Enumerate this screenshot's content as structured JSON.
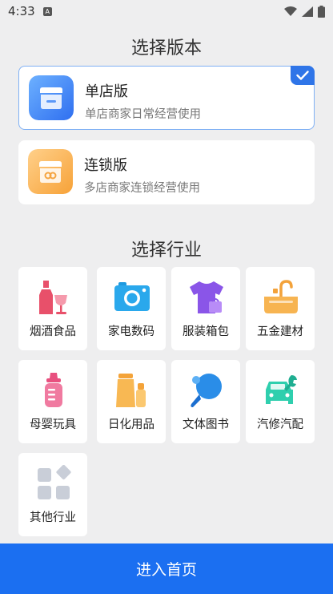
{
  "status_bar": {
    "time": "4:33",
    "notification_badge": "A"
  },
  "version_section": {
    "title": "选择版本",
    "options": [
      {
        "name": "单店版",
        "description": "单店商家日常经营使用",
        "selected": true
      },
      {
        "name": "连锁版",
        "description": "多店商家连锁经营使用",
        "selected": false
      }
    ]
  },
  "industry_section": {
    "title": "选择行业",
    "items": [
      {
        "label": "烟酒食品",
        "icon": "wine-bottle-icon"
      },
      {
        "label": "家电数码",
        "icon": "camera-icon"
      },
      {
        "label": "服装箱包",
        "icon": "tshirt-icon"
      },
      {
        "label": "五金建材",
        "icon": "faucet-sink-icon"
      },
      {
        "label": "母婴玩具",
        "icon": "baby-bottle-icon"
      },
      {
        "label": "日化用品",
        "icon": "cosmetics-icon"
      },
      {
        "label": "文体图书",
        "icon": "ping-pong-icon"
      },
      {
        "label": "汽修汽配",
        "icon": "car-wrench-icon"
      },
      {
        "label": "其他行业",
        "icon": "grid-apps-icon"
      }
    ]
  },
  "enter_button": {
    "label": "进入首页"
  },
  "colors": {
    "primary": "#1b6ff1",
    "selected_border": "#7fb0f4",
    "background": "#eeeeef"
  }
}
